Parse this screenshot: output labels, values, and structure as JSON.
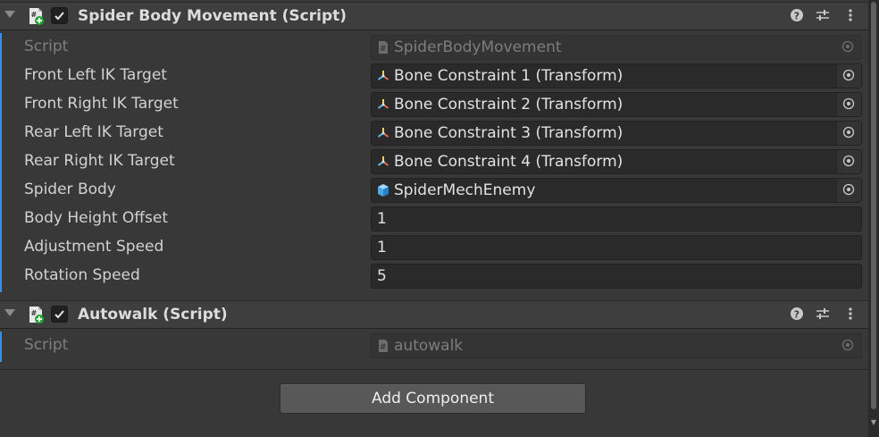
{
  "components": [
    {
      "title": "Spider Body Movement (Script)",
      "enabled": true,
      "fields": [
        {
          "label": "Script",
          "value": "SpiderBodyMovement",
          "kind": "script",
          "disabled": true
        },
        {
          "label": "Front Left IK Target",
          "value": "Bone Constraint 1 (Transform)",
          "kind": "transform"
        },
        {
          "label": "Front Right IK Target",
          "value": "Bone Constraint 2 (Transform)",
          "kind": "transform"
        },
        {
          "label": "Rear Left IK Target",
          "value": "Bone Constraint 3 (Transform)",
          "kind": "transform"
        },
        {
          "label": "Rear Right IK Target",
          "value": "Bone Constraint 4 (Transform)",
          "kind": "transform"
        },
        {
          "label": "Spider Body",
          "value": "SpiderMechEnemy",
          "kind": "gameobject"
        },
        {
          "label": "Body Height Offset",
          "value": "1",
          "kind": "number"
        },
        {
          "label": "Adjustment Speed",
          "value": "1",
          "kind": "number"
        },
        {
          "label": "Rotation Speed",
          "value": "5",
          "kind": "number"
        }
      ]
    },
    {
      "title": "Autowalk (Script)",
      "enabled": true,
      "fields": [
        {
          "label": "Script",
          "value": "autowalk",
          "kind": "script",
          "disabled": true
        }
      ]
    }
  ],
  "add_component_label": "Add Component",
  "icons": {
    "script": "cs-script-icon",
    "transform": "transform-axis-icon",
    "gameobject": "prefab-cube-icon",
    "picker": "object-picker-icon",
    "help": "help-icon",
    "presets": "presets-icon",
    "menu": "kebab-menu-icon"
  },
  "colors": {
    "accent": "#3c8ee0",
    "background": "#383838",
    "header": "#3e3e3e",
    "field": "#2a2a2a"
  }
}
